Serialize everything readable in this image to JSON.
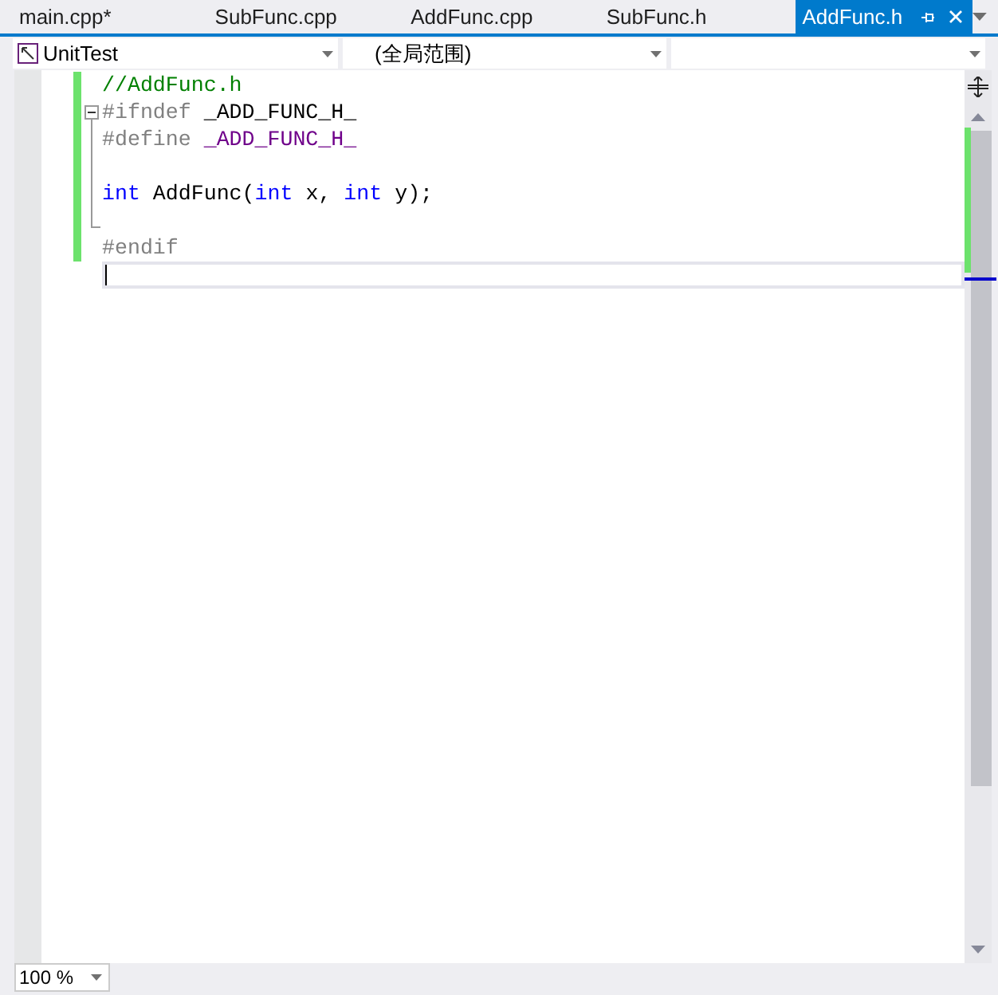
{
  "tabs": [
    {
      "label": "main.cpp*",
      "selected": false
    },
    {
      "label": "SubFunc.cpp",
      "selected": false
    },
    {
      "label": "AddFunc.cpp",
      "selected": false
    },
    {
      "label": "SubFunc.h",
      "selected": false
    },
    {
      "label": "AddFunc.h",
      "selected": true
    }
  ],
  "nav_bar": {
    "project": "UnitTest",
    "scope": "(全局范围)"
  },
  "editor": {
    "lines": [
      {
        "changed": true,
        "in_fold": false,
        "current": false,
        "tokens": [
          {
            "kind": "comment",
            "text": "//AddFunc.h"
          }
        ]
      },
      {
        "changed": true,
        "in_fold": false,
        "expanded": true,
        "current": false,
        "tokens": [
          {
            "kind": "preproc",
            "text": "#ifndef "
          },
          {
            "kind": "plain",
            "text": "_ADD_FUNC_H_"
          }
        ]
      },
      {
        "changed": true,
        "in_fold": true,
        "current": false,
        "tokens": [
          {
            "kind": "preproc",
            "text": "#define "
          },
          {
            "kind": "macro",
            "text": "_ADD_FUNC_H_"
          }
        ]
      },
      {
        "changed": true,
        "in_fold": true,
        "current": false
      },
      {
        "changed": true,
        "in_fold": true,
        "current": false,
        "tokens": [
          {
            "kind": "keyword",
            "text": "int"
          },
          {
            "kind": "plain",
            "text": " AddFunc("
          },
          {
            "kind": "keyword",
            "text": "int"
          },
          {
            "kind": "plain",
            "text": " x, "
          },
          {
            "kind": "keyword",
            "text": "int"
          },
          {
            "kind": "plain",
            "text": " y);"
          }
        ]
      },
      {
        "changed": true,
        "in_fold": true,
        "current": false
      },
      {
        "changed": true,
        "in_fold": false,
        "current": false,
        "tokens": [
          {
            "kind": "preproc",
            "text": "#endif"
          }
        ]
      },
      {
        "changed": false,
        "in_fold": false,
        "current": true
      }
    ]
  },
  "zoom": "100 %"
}
